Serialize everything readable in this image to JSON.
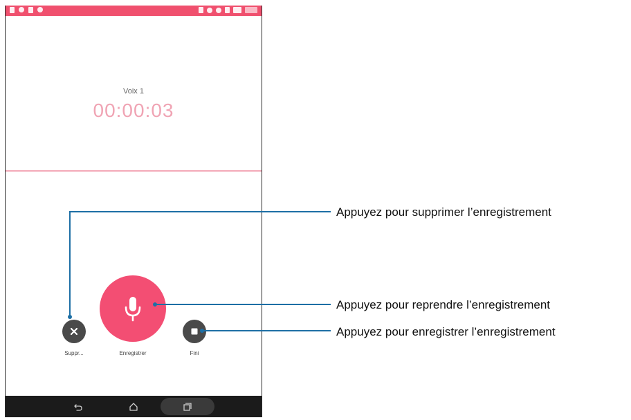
{
  "recording": {
    "name": "Voix 1",
    "elapsed": "00:00:03"
  },
  "controls": {
    "delete_label": "Suppr...",
    "record_label": "Enregistrer",
    "done_label": "Fini"
  },
  "callouts": {
    "delete": "Appuyez pour supprimer l’enregistrement",
    "resume": "Appuyez pour reprendre l’enregistrement",
    "save": "Appuyez pour enregistrer l’enregistrement"
  },
  "colors": {
    "accent": "#f34e73",
    "status_bar": "#f0506e",
    "timer": "#f0a4b4",
    "leader_line": "#1d6fa5"
  },
  "icons": {
    "delete": "close-icon",
    "record": "microphone-icon",
    "done": "stop-icon",
    "nav_back": "back-icon",
    "nav_home": "home-icon",
    "nav_recent": "recent-apps-icon"
  }
}
